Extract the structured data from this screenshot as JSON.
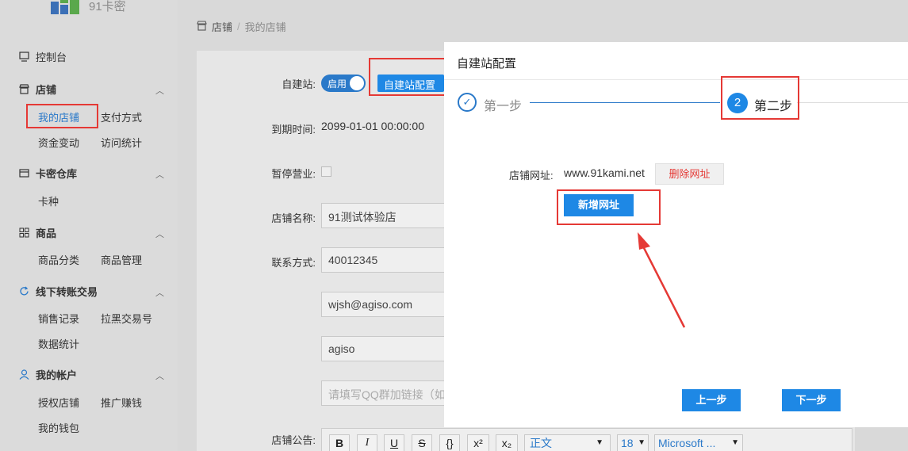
{
  "app": {
    "logo_text": "91卡密"
  },
  "sidebar": {
    "dashboard": "控制台",
    "shop": "店铺",
    "my_shop": "我的店铺",
    "payment": "支付方式",
    "fund_change": "资金变动",
    "visit_stats": "访问统计",
    "warehouse": "卡密仓库",
    "card_type": "卡种",
    "goods": "商品",
    "goods_category": "商品分类",
    "goods_manage": "商品管理",
    "offline": "线下转账交易",
    "sales_record": "销售记录",
    "blacklist": "拉黑交易号",
    "data_stats": "数据统计",
    "account": "我的帐户",
    "auth_shop": "授权店铺",
    "promote": "推广赚钱",
    "wallet": "我的钱包"
  },
  "breadcrumb": {
    "root": "店铺",
    "sep": "/",
    "current": "我的店铺"
  },
  "form": {
    "self_site_label": "自建站:",
    "toggle_label": "启用",
    "self_site_config_button": "自建站配置",
    "expire_label": "到期时间:",
    "expire_value": "2099-01-01 00:00:00",
    "pause_label": "暂停营业:",
    "shop_name_label": "店铺名称:",
    "shop_name_value": "91测试体验店",
    "contact_label": "联系方式:",
    "phone_value": "40012345",
    "email_value": "wjsh@agiso.com",
    "wechat_value": "agiso",
    "qq_placeholder": "请填写QQ群加链接（如",
    "notice_label": "店铺公告:"
  },
  "editor_toolbar": {
    "bold": "B",
    "italic": "I",
    "underline": "U",
    "strike": "S",
    "code": "{}",
    "sup": "x²",
    "sub": "x₂",
    "para": "正文",
    "size": "18",
    "font": "Microsoft ..."
  },
  "modal": {
    "title": "自建站配置",
    "step1_label": "第一步",
    "step2_number": "2",
    "step2_label": "第二步",
    "url_label": "店铺网址:",
    "url_value": "www.91kami.net",
    "delete_url_button": "删除网址",
    "add_url_button": "新增网址",
    "prev_button": "上一步",
    "next_button": "下一步"
  },
  "colors": {
    "accent": "#1e88e5",
    "highlight": "#e53935",
    "danger_text": "#e53935"
  }
}
